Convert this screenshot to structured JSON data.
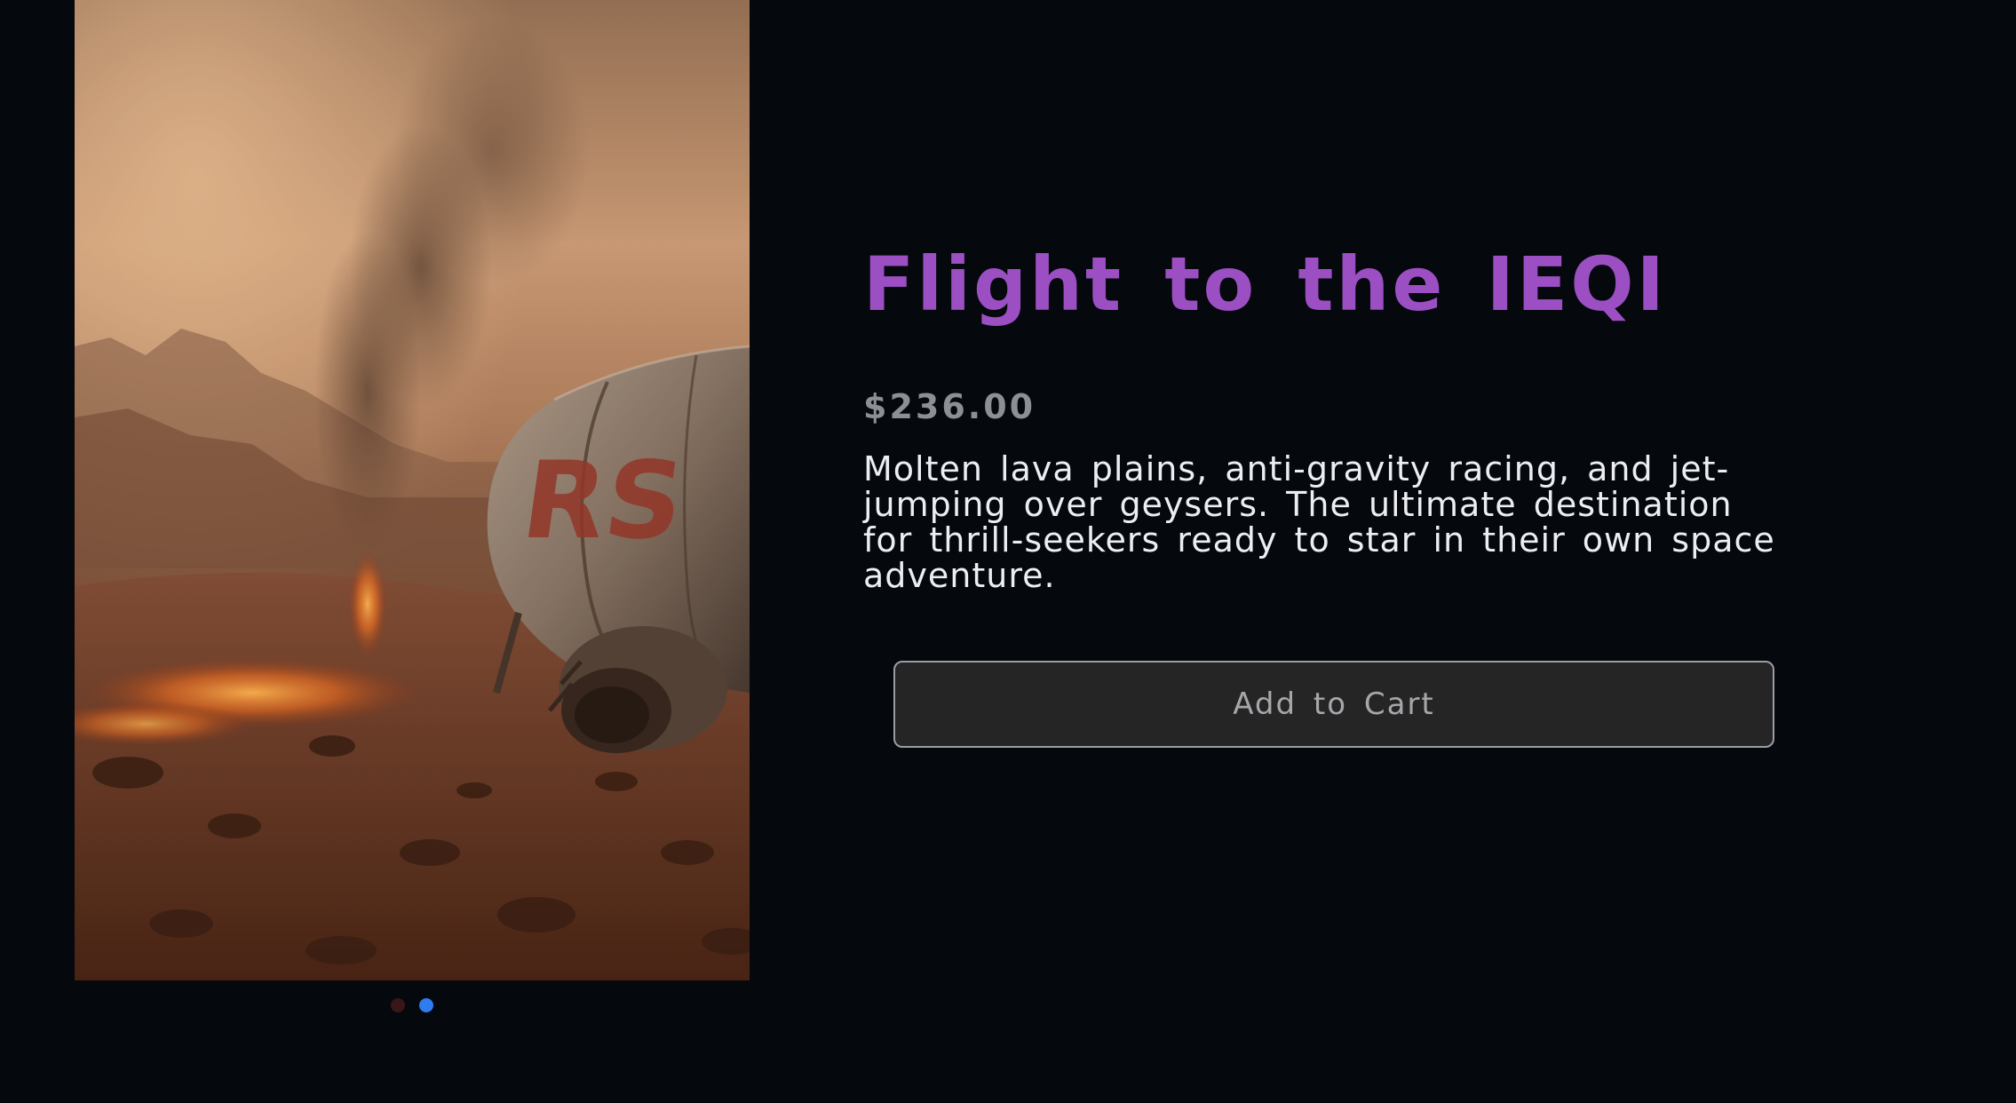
{
  "product": {
    "title": "Flight to the IEQI",
    "price": "$236.00",
    "description": "Molten lava plains, anti-gravity racing, and jet-jumping over geysers. The ultimate destination for thrill-seekers ready to star in their own space adventure.",
    "add_to_cart_label": "Add to Cart",
    "image_marking": "RS"
  },
  "gallery": {
    "slide_count": 2,
    "active_slide": 2
  },
  "colors": {
    "background": "#05080c",
    "title": "#9b4fc2",
    "price": "#8c8f94",
    "description": "#eceef2",
    "button_bg": "#252526",
    "button_border": "#9a9da3",
    "dot_active": "#2f7bf0",
    "dot_inactive": "#3a1616"
  }
}
